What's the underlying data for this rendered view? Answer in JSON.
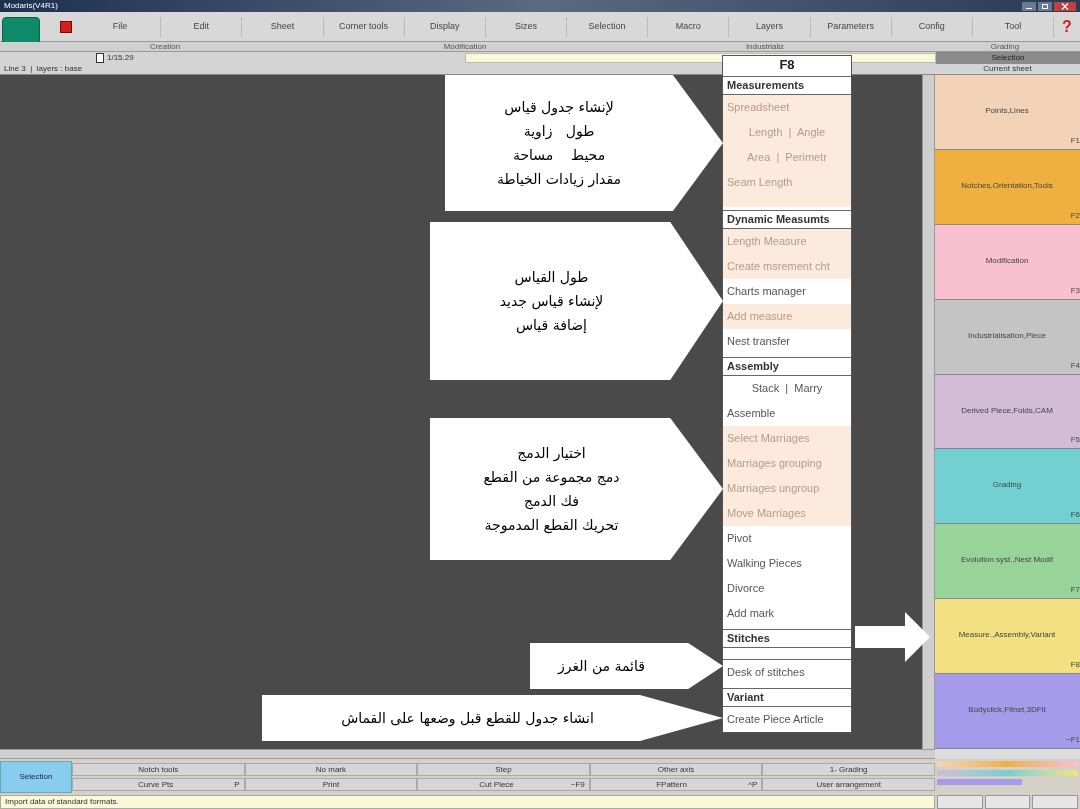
{
  "window": {
    "title": "Modaris(V4R1)"
  },
  "menu_bar": [
    "File",
    "Edit",
    "Sheet",
    "Corner tools",
    "Display",
    "Sizes",
    "Selection",
    "Macro",
    "Layers",
    "Parameters",
    "Config",
    "Tool"
  ],
  "help": "?",
  "sections": [
    "Creation",
    "Modification",
    "Industrializ",
    "Grading"
  ],
  "file_field": {
    "value": "1/15.29"
  },
  "line_info": "Line 3  |  layers : base",
  "right_panel": {
    "tab": "Selection",
    "sheet": "Current sheet",
    "groups": [
      {
        "label": "Points,Lines",
        "key": "F1",
        "color": "#f2d3b8"
      },
      {
        "label": "Notches,Orientation,Tools",
        "key": "F2",
        "color": "#f0b040"
      },
      {
        "label": "Modification",
        "key": "F3",
        "color": "#f8c0d0"
      },
      {
        "label": "Industrialisation,Piece",
        "key": "F4",
        "color": "#c4c4c4"
      },
      {
        "label": "Derived Piece,Folds,CAM",
        "key": "F5",
        "color": "#d2bcd8"
      },
      {
        "label": "Grading",
        "key": "F6",
        "color": "#72d0d0"
      },
      {
        "label": "Evolution syst.,Nest Modif",
        "key": "F7",
        "color": "#98d49a"
      },
      {
        "label": "Measure.,Assembly,Variant",
        "key": "F8",
        "color": "#f2e082"
      },
      {
        "label": "Bodyclick,Fitnet,3DFit",
        "key": "~F1",
        "color": "#a69aea"
      }
    ]
  },
  "f8_menu": {
    "title": "F8",
    "rows": [
      {
        "kind": "header",
        "label": "Measurements"
      },
      {
        "kind": "item",
        "label": "Spreadsheet",
        "highlighted": true
      },
      {
        "kind": "pair",
        "label": "Length  |  Angle",
        "highlighted": true
      },
      {
        "kind": "pair",
        "label": "Area  |  Perimetr",
        "highlighted": true
      },
      {
        "kind": "item",
        "label": "Seam Length",
        "highlighted": true
      },
      {
        "kind": "spacer",
        "highlighted": true
      },
      {
        "kind": "header",
        "label": "Dynamic Measumts"
      },
      {
        "kind": "item",
        "label": "Length Measure",
        "highlighted": true
      },
      {
        "kind": "item",
        "label": "Create msrement cht",
        "highlighted": true
      },
      {
        "kind": "item",
        "label": "Charts manager",
        "highlighted": false
      },
      {
        "kind": "item",
        "label": "Add measure",
        "highlighted": true
      },
      {
        "kind": "item",
        "label": "Nest transfer",
        "highlighted": false
      },
      {
        "kind": "header",
        "label": "Assembly"
      },
      {
        "kind": "pair",
        "label": "Stack  |  Marry",
        "highlighted": false
      },
      {
        "kind": "item",
        "label": "Assemble",
        "highlighted": false
      },
      {
        "kind": "item",
        "label": "Select Marriages",
        "highlighted": true
      },
      {
        "kind": "item",
        "label": "Marriages grouping",
        "highlighted": true
      },
      {
        "kind": "item",
        "label": "Marriages ungroup",
        "highlighted": true
      },
      {
        "kind": "item",
        "label": "Move Marriages",
        "highlighted": true
      },
      {
        "kind": "item",
        "label": "Pivot",
        "highlighted": false
      },
      {
        "kind": "item",
        "label": "Walking Pieces",
        "highlighted": false
      },
      {
        "kind": "item",
        "label": "Divorce",
        "highlighted": false
      },
      {
        "kind": "item",
        "label": "Add mark",
        "highlighted": false
      },
      {
        "kind": "header",
        "label": "Stitches"
      },
      {
        "kind": "spacer",
        "highlighted": false
      },
      {
        "kind": "item",
        "label": "Desk of stitches",
        "highlighted": false
      },
      {
        "kind": "header",
        "label": "Variant"
      },
      {
        "kind": "item",
        "label": "Create Piece Article",
        "highlighted": false
      }
    ]
  },
  "callouts": [
    {
      "lines": [
        "لإنشاء جدول قياس",
        "طول   زاوية",
        "محيط    مساحة",
        "مقدار زيادات الخياطة"
      ]
    },
    {
      "lines": [
        "طول القياس",
        "لإنشاء قياس جديد",
        "إضافة قياس"
      ]
    },
    {
      "lines": [
        "اختيار الدمج",
        "دمج مجموعة من القطع",
        "فك الدمج",
        "تحريك القطع المدموجة"
      ]
    },
    {
      "lines": [
        "قائمة من الغرز"
      ]
    },
    {
      "lines": [
        "انشاء جدول للقطع قبل وضعها على القماش"
      ]
    }
  ],
  "toolbar": {
    "mode": "Selection",
    "rows": [
      [
        {
          "label": "Notch tools"
        },
        {
          "label": "No mark"
        },
        {
          "label": "Step"
        },
        {
          "label": "Other axis"
        },
        {
          "label": "1- Grading"
        }
      ],
      [
        {
          "label": "Curve Pts",
          "shortcut": "P"
        },
        {
          "label": "Print"
        },
        {
          "label": "Cut Piece",
          "shortcut": "~F9"
        },
        {
          "label": "FPattern",
          "shortcut": "^P"
        },
        {
          "label": "User arrangement"
        }
      ]
    ]
  },
  "status_bar": "Import data of standard formats."
}
